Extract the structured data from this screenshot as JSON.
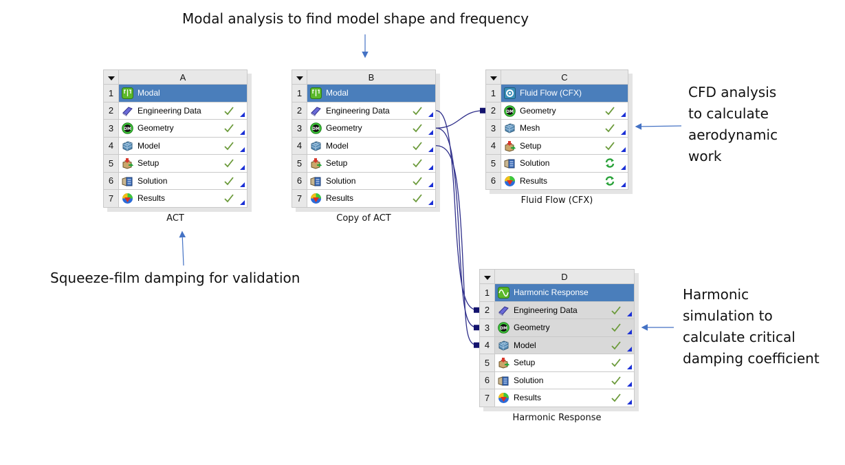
{
  "annotations": {
    "top": "Modal analysis to find model shape and frequency",
    "bottom_left": "Squeeze-film damping for validation",
    "cfd": [
      "CFD analysis",
      "to calculate",
      "aerodynamic",
      "work"
    ],
    "harmonic": [
      "Harmonic",
      "simulation to",
      "calculate critical",
      "damping coefficient"
    ]
  },
  "colors": {
    "selected_row": "#4a7ebb",
    "connector": "#2e2e8a",
    "link_square": "#13136e",
    "arrow": "#4472c4",
    "check": "#6b9a3a",
    "corner_triangle": "#1a2fd6"
  },
  "systems": [
    {
      "id": "A",
      "caption": "ACT",
      "rows": [
        {
          "num": "1",
          "icon": "modal-icon",
          "label": "Modal",
          "status": "",
          "selected": true
        },
        {
          "num": "2",
          "icon": "engineering-data-icon",
          "label": "Engineering Data",
          "status": "check"
        },
        {
          "num": "3",
          "icon": "geometry-dm-icon",
          "label": "Geometry",
          "status": "check"
        },
        {
          "num": "4",
          "icon": "model-mesh-icon",
          "label": "Model",
          "status": "check"
        },
        {
          "num": "5",
          "icon": "setup-icon",
          "label": "Setup",
          "status": "check"
        },
        {
          "num": "6",
          "icon": "solution-icon",
          "label": "Solution",
          "status": "check"
        },
        {
          "num": "7",
          "icon": "results-icon",
          "label": "Results",
          "status": "check"
        }
      ]
    },
    {
      "id": "B",
      "caption": "Copy of ACT",
      "rows": [
        {
          "num": "1",
          "icon": "modal-icon",
          "label": "Modal",
          "status": "",
          "selected": true
        },
        {
          "num": "2",
          "icon": "engineering-data-icon",
          "label": "Engineering Data",
          "status": "check"
        },
        {
          "num": "3",
          "icon": "geometry-dm-icon",
          "label": "Geometry",
          "status": "check"
        },
        {
          "num": "4",
          "icon": "model-mesh-icon",
          "label": "Model",
          "status": "check"
        },
        {
          "num": "5",
          "icon": "setup-icon",
          "label": "Setup",
          "status": "check"
        },
        {
          "num": "6",
          "icon": "solution-icon",
          "label": "Solution",
          "status": "check"
        },
        {
          "num": "7",
          "icon": "results-icon",
          "label": "Results",
          "status": "check"
        }
      ]
    },
    {
      "id": "C",
      "caption": "Fluid Flow (CFX)",
      "rows": [
        {
          "num": "1",
          "icon": "cfx-icon",
          "label": "Fluid Flow (CFX)",
          "status": "",
          "selected": true
        },
        {
          "num": "2",
          "icon": "geometry-dm-icon",
          "label": "Geometry",
          "status": "check"
        },
        {
          "num": "3",
          "icon": "model-mesh-icon",
          "label": "Mesh",
          "status": "check"
        },
        {
          "num": "4",
          "icon": "setup-icon",
          "label": "Setup",
          "status": "check"
        },
        {
          "num": "5",
          "icon": "solution-icon",
          "label": "Solution",
          "status": "refresh"
        },
        {
          "num": "6",
          "icon": "results-icon",
          "label": "Results",
          "status": "refresh"
        }
      ]
    },
    {
      "id": "D",
      "caption": "Harmonic Response",
      "rows": [
        {
          "num": "1",
          "icon": "harmonic-icon",
          "label": "Harmonic Response",
          "status": "",
          "selected": true
        },
        {
          "num": "2",
          "icon": "engineering-data-icon",
          "label": "Engineering Data",
          "status": "check",
          "shared": true
        },
        {
          "num": "3",
          "icon": "geometry-dm-icon",
          "label": "Geometry",
          "status": "check",
          "shared": true
        },
        {
          "num": "4",
          "icon": "model-mesh-icon",
          "label": "Model",
          "status": "check",
          "shared": true
        },
        {
          "num": "5",
          "icon": "setup-icon",
          "label": "Setup",
          "status": "check"
        },
        {
          "num": "6",
          "icon": "solution-icon",
          "label": "Solution",
          "status": "check"
        },
        {
          "num": "7",
          "icon": "results-icon",
          "label": "Results",
          "status": "check"
        }
      ]
    }
  ],
  "connections": [
    {
      "from": "B3",
      "to": "C2"
    },
    {
      "from": "B2",
      "to": "D2"
    },
    {
      "from": "B3",
      "to": "D3"
    },
    {
      "from": "B4",
      "to": "D4"
    }
  ]
}
